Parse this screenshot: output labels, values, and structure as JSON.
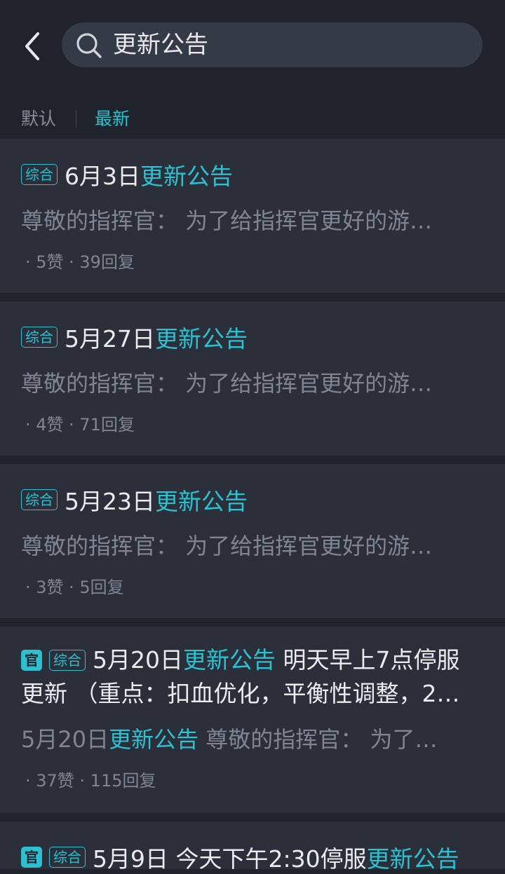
{
  "header": {
    "back_icon": "chevron-left-icon",
    "search_icon": "search-icon",
    "search_value": "更新公告"
  },
  "sort": {
    "default_label": "默认",
    "latest_label": "最新",
    "active": "最新"
  },
  "colors": {
    "accent": "#2cc0d0",
    "background": "#1f232b",
    "card": "#2a2f3a",
    "muted_text": "#7f8591"
  },
  "posts": [
    {
      "tag": "综合",
      "title_prefix": "6月3日",
      "title_highlight": "更新公告",
      "excerpt": "尊敬的指挥官： 为了给指挥官更好的游…",
      "stats": "· 5赞 · 39回复"
    },
    {
      "tag": "综合",
      "title_prefix": "5月27日",
      "title_highlight": "更新公告",
      "excerpt": "尊敬的指挥官： 为了给指挥官更好的游…",
      "stats": "· 4赞 · 71回复"
    },
    {
      "tag": "综合",
      "title_prefix": "5月23日",
      "title_highlight": "更新公告",
      "excerpt": "尊敬的指挥官： 为了给指挥官更好的游…",
      "stats": "· 3赞 · 5回复"
    },
    {
      "official_tag": "官",
      "tag": "综合",
      "title_prefix": "5月20日",
      "title_highlight": "更新公告",
      "title_suffix": " 明天早上7点停服",
      "title_line2": "更新 （重点：扣血优化，平衡性调整，2…",
      "excerpt_prefix": "5月20日",
      "excerpt_highlight": "更新公告",
      "excerpt_suffix": " 尊敬的指挥官： 为了…",
      "stats": "· 37赞 · 115回复"
    },
    {
      "official_tag": "官",
      "tag": "综合",
      "title_prefix": "5月9日 今天下午2:30停服",
      "title_highlight": "更新公告"
    }
  ]
}
